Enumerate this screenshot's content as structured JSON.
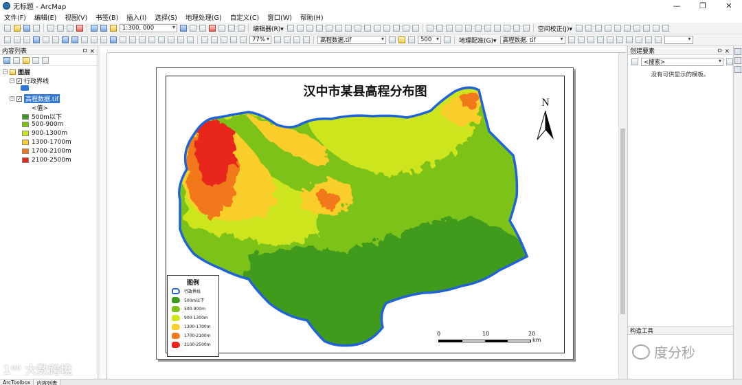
{
  "window": {
    "title": "无标题 - ArcMap"
  },
  "menu": [
    "文件(F)",
    "编辑(E)",
    "视图(V)",
    "书签(B)",
    "插入(I)",
    "选择(S)",
    "地理处理(G)",
    "自定义(C)",
    "窗口(W)",
    "帮助(H)"
  ],
  "toolbar1": {
    "scale_value": "1:300, 000",
    "editor_label": "编辑器(R)▾",
    "spatial_adjust_label": "空间校正(J)▾"
  },
  "toolbar2": {
    "zoom_value": "77%",
    "raster_layer": "高程数据.tif",
    "value_500": "500",
    "georef_label": "地理配准(G)▾",
    "georef_layer": "高程数据. tif"
  },
  "toc": {
    "header": "内容列表",
    "group": "图层",
    "boundary_layer": "行政界线",
    "raster_layer": "高程数据.tif",
    "value_label": "<值>",
    "classes": [
      {
        "label": "500m以下",
        "color": "#3f9a1f"
      },
      {
        "label": "500-900m",
        "color": "#7cc218"
      },
      {
        "label": "900-1300m",
        "color": "#cde51a"
      },
      {
        "label": "1300-1700m",
        "color": "#f9cd2a"
      },
      {
        "label": "1700-2100m",
        "color": "#f2781c"
      },
      {
        "label": "2100-2500m",
        "color": "#e8261a"
      }
    ]
  },
  "map": {
    "title": "汉中市某县高程分布图",
    "north": "N",
    "legend_title": "图例",
    "legend_items": [
      "行政界线",
      "500m以下",
      "500-900m",
      "900-1300m",
      "1300-1700m",
      "1700-2100m",
      "2100-2500m"
    ],
    "scale_labels": [
      "0",
      "10",
      "20"
    ],
    "scale_unit": "km",
    "boundary_color": "#1f63d6"
  },
  "right_panel": {
    "header": "创建要素",
    "search_placeholder": "<搜索>",
    "empty_text": "没有可供显示的模板。",
    "construct_tools": "构造工具"
  },
  "bottom_tabs": [
    "ArcToolbox",
    "内容列表"
  ],
  "watermarks": {
    "left": "大数跨境",
    "right": "度分秒"
  }
}
